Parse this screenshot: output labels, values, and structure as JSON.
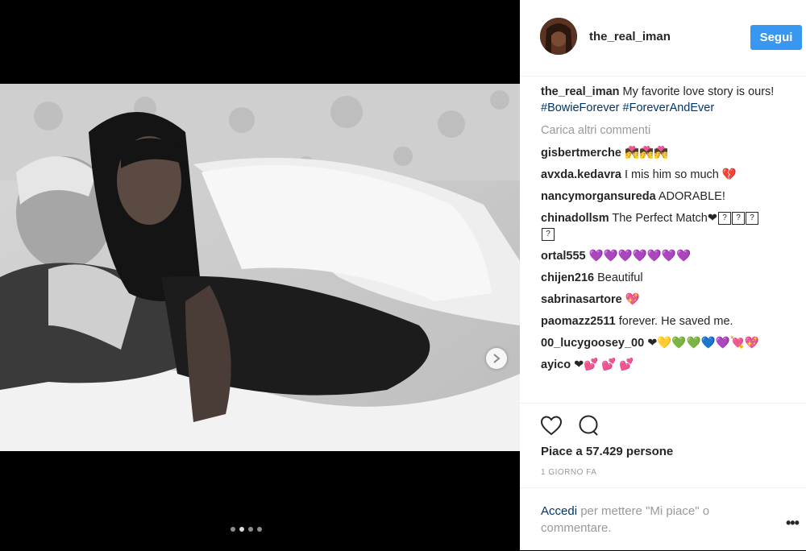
{
  "post": {
    "username": "the_real_iman",
    "follow_label": "Segui",
    "caption": {
      "username": "the_real_iman",
      "text": " My favorite love story is ours! ",
      "hashtags": [
        "#BowieForever",
        "#ForeverAndEver"
      ]
    },
    "load_more": "Carica altri commenti",
    "comments": [
      {
        "user": "gisbertmerche",
        "text": " 💏💏💏"
      },
      {
        "user": "avxda.kedavra",
        "text": " I mis him so much 💔"
      },
      {
        "user": "nancymorgansureda",
        "text": " ADORABLE!"
      },
      {
        "user": "chinadollsm",
        "text": " The Perfect Match❤"
      },
      {
        "user": "ortal555",
        "text": " 💜💜💜💜💜💜💜"
      },
      {
        "user": "chijen216",
        "text": " Beautiful"
      },
      {
        "user": "sabrinasartore",
        "text": " 💖"
      },
      {
        "user": "paomazz2511",
        "text": " forever. He saved me."
      },
      {
        "user": "00_lucygoosey_00",
        "text": " ❤💛💚💚💙💜💘💖"
      },
      {
        "user": "ayico",
        "text": " ❤💕 💕 💕"
      }
    ],
    "likes_label": "Piace a 57.429 persone",
    "time_label": "1 GIORNO FA",
    "login_link": "Accedi",
    "login_text": " per mettere \"Mi piace\" o commentare.",
    "more_label": "•••"
  },
  "carousel": {
    "slide_count": 4,
    "active_index": 1
  },
  "colors": {
    "follow": "#3897f0",
    "link": "#003569",
    "muted": "#999999"
  },
  "icons": [
    "heart-icon",
    "comment-icon",
    "chevron-right-icon"
  ]
}
